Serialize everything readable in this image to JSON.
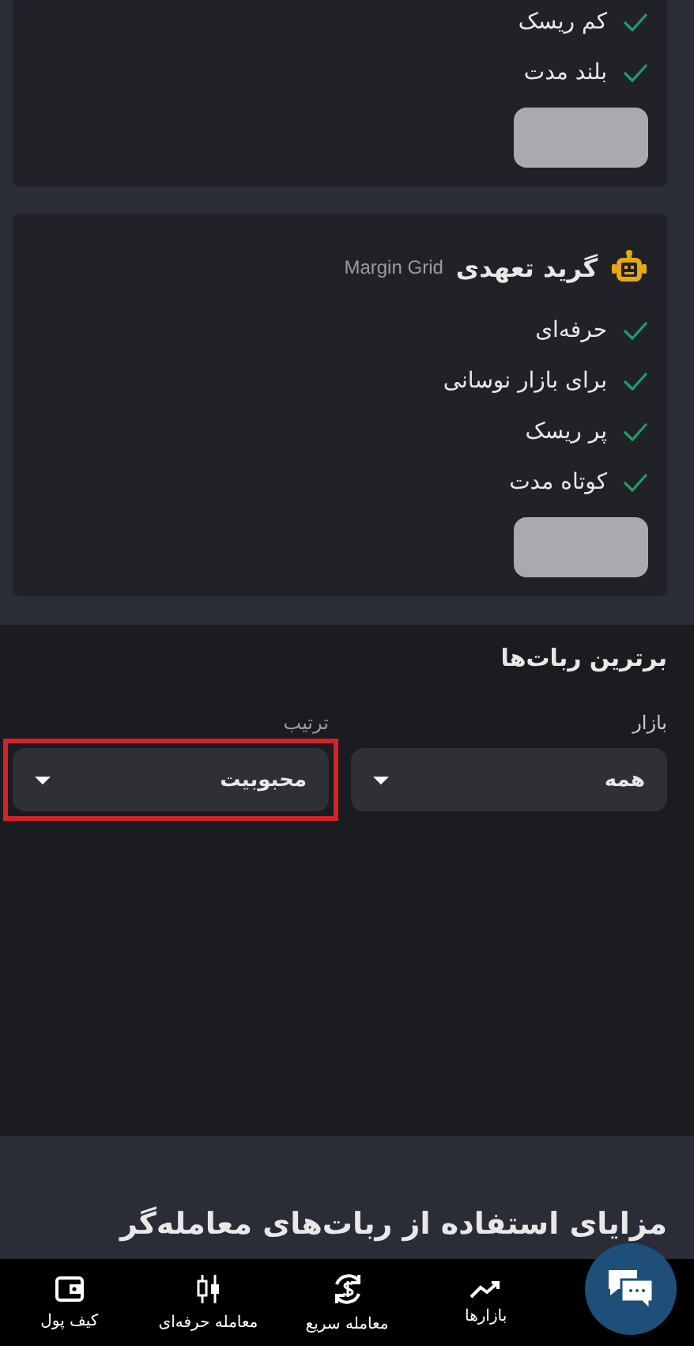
{
  "bot_cards": [
    {
      "features": [
        {
          "text": "کم ریسک"
        },
        {
          "text": "بلند مدت"
        }
      ],
      "button": {
        "disabled": true
      }
    },
    {
      "title": "گرید تعهدی",
      "subtitle": "Margin Grid",
      "features": [
        {
          "text": "حرفه‌ای"
        },
        {
          "text": "برای بازار نوسانی"
        },
        {
          "text": "پر ریسک"
        },
        {
          "text": "کوتاه مدت"
        }
      ],
      "button": {
        "disabled": true
      }
    }
  ],
  "top_bots": {
    "title": "برترین ربات‌ها",
    "filters": [
      {
        "label": "بازار",
        "value": "همه",
        "highlighted": false
      },
      {
        "label": "ترتیب",
        "value": "محبوبیت",
        "highlighted": true
      }
    ]
  },
  "benefits": {
    "title": "مزایای استفاده از ربات‌های معامله‌گر"
  },
  "bottom_nav": [
    {
      "kind": "chart",
      "label": "بازارها"
    },
    {
      "kind": "exchange",
      "label": "معامله سریع"
    },
    {
      "kind": "candles",
      "label": "معامله حرفه‌ای"
    },
    {
      "kind": "wallet",
      "label": "کیف پول"
    }
  ]
}
